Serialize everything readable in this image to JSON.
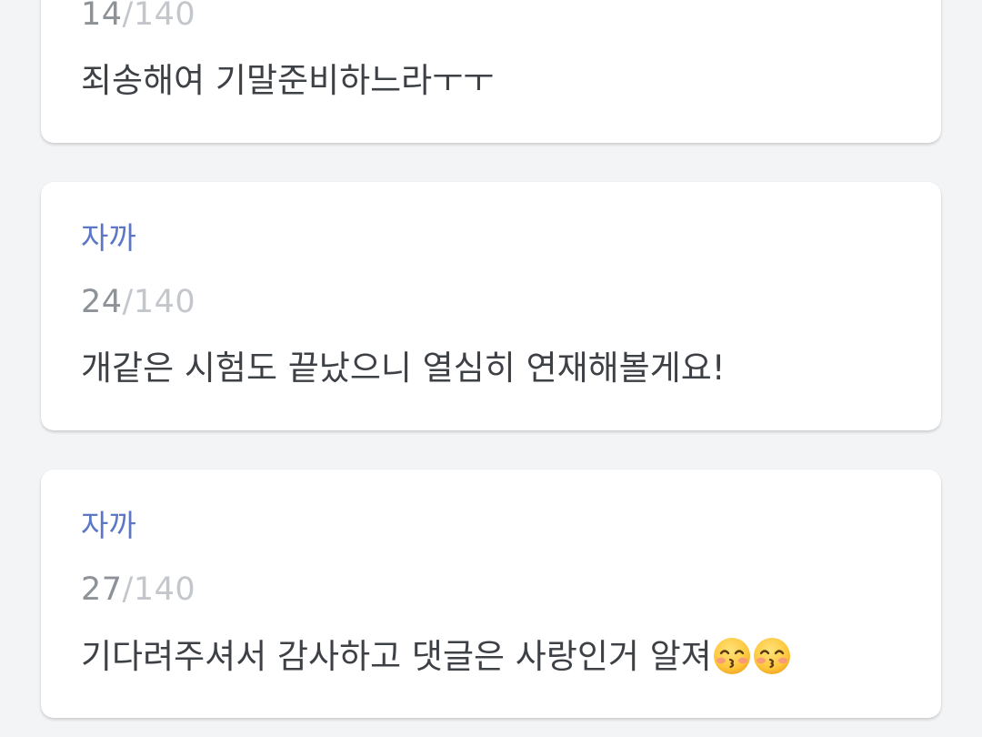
{
  "comments": [
    {
      "author": "",
      "count_current": "14",
      "count_separator": "/",
      "count_total": "140",
      "text": "죄송해여 기말준비하느라ㅜㅜ"
    },
    {
      "author": "자까",
      "count_current": "24",
      "count_separator": "/",
      "count_total": "140",
      "text": "개같은 시험도 끝났으니 열심히 연재해볼게요!"
    },
    {
      "author": "자까",
      "count_current": "27",
      "count_separator": "/",
      "count_total": "140",
      "text": "기다려주셔서 감사하고 댓글은 사랑인거 알져",
      "emojis": [
        "kissing-smiling-eyes-emoji",
        "kissing-smiling-eyes-emoji"
      ]
    }
  ],
  "colors": {
    "background": "#f3f4f6",
    "card": "#ffffff",
    "author": "#5b77c6",
    "counter_current": "#8d9298",
    "counter_total": "#c3c7cc",
    "text": "#3d4045"
  }
}
